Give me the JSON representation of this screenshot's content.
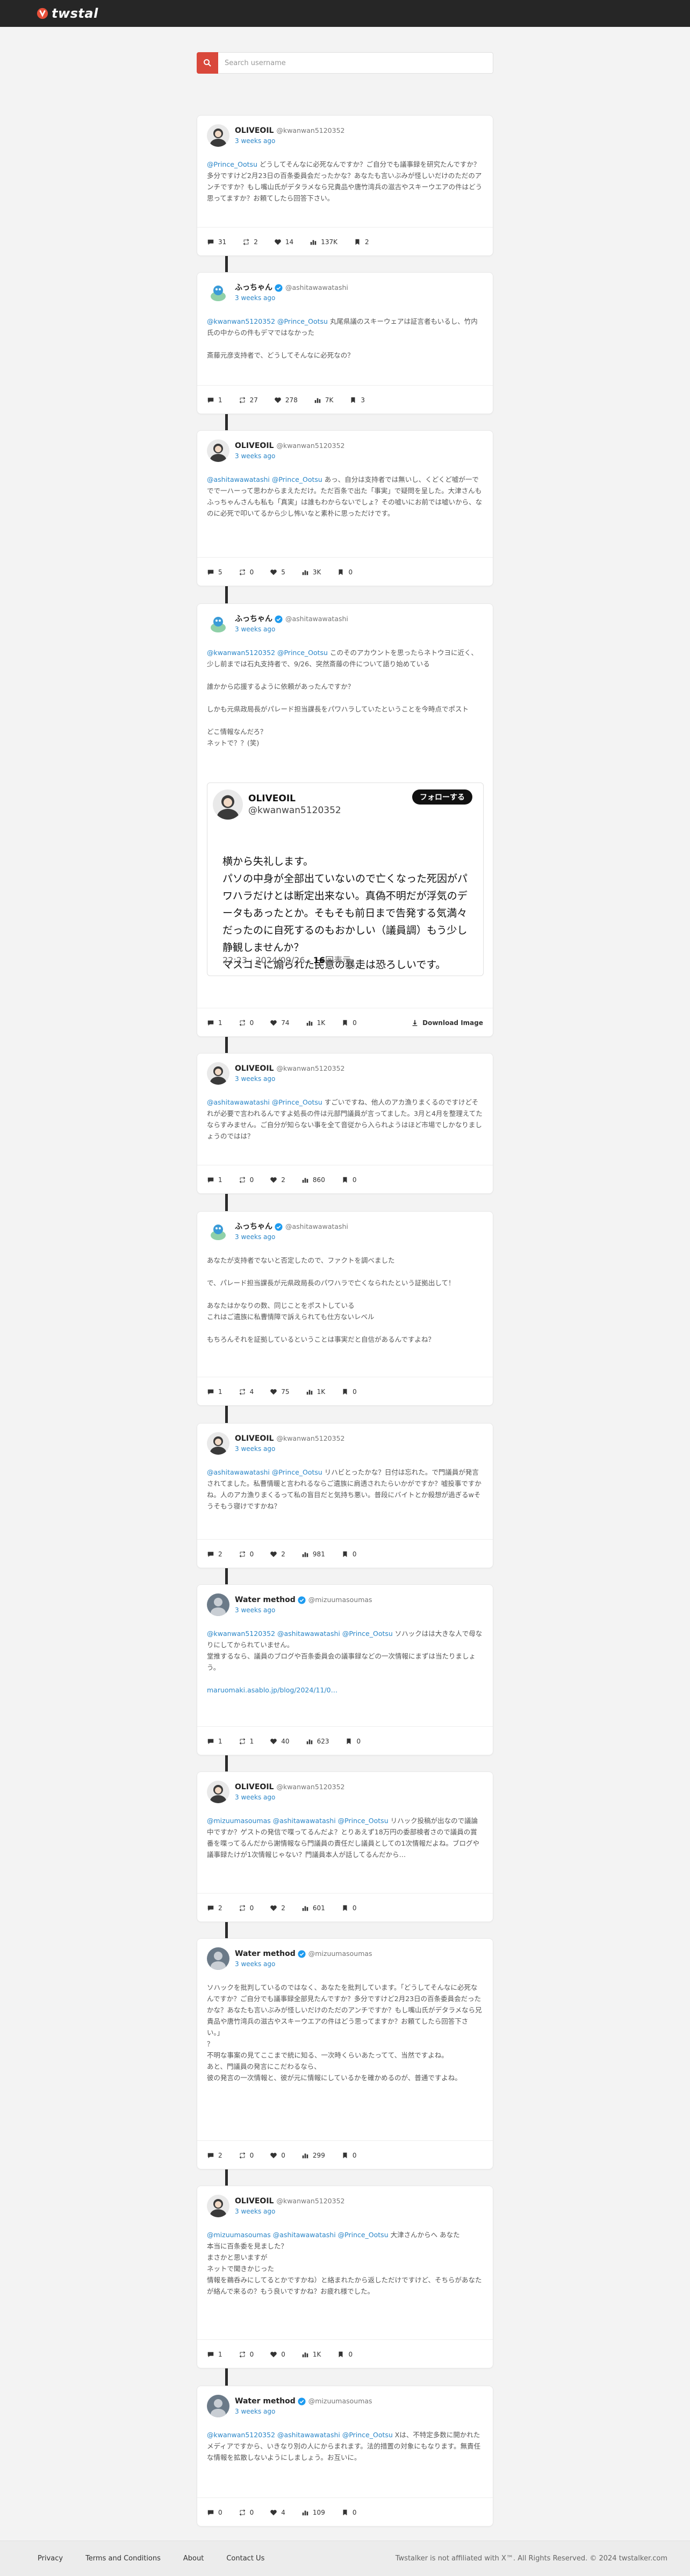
{
  "brand": {
    "name": "twstal"
  },
  "search": {
    "placeholder": "Search username",
    "icon": "search-icon"
  },
  "posts": [
    {
      "name": "OLIVEOIL",
      "handle": "@kwanwan5120352",
      "time": "3 weeks ago",
      "verified": false,
      "avatar": "olive",
      "body": [
        {
          "m": "@Prince_Ootsu"
        },
        {
          "t": " どうしてそんなに必死なんですか？ご自分でも議事録を研究たんですか？多分ですけど2月23日の百条委員会だったかな？あなたも言いぶみが怪しいだけのただのアンチですか？もし嘴山氏がデタラメなら兄貴品や唐竹湾兵の滋古やスキーウエアの件はどう思ってますか？お頼てしたら回答下さい。"
        }
      ],
      "stats": {
        "reply": "31",
        "retweet": "2",
        "like": "14",
        "view": "137K",
        "bookmark": "2"
      }
    },
    {
      "name": "ふっちゃん",
      "handle": "@ashitawawatashi",
      "time": "3 weeks ago",
      "verified": true,
      "avatar": "fucchan",
      "body": [
        {
          "m": "@kwanwan5120352 @Prince_Ootsu"
        },
        {
          "t": " 丸尾県議のスキーウェアは証言者もいるし、竹内氏の中からの件もデマではなかった\n\n斎藤元彦支持者で、どうしてそんなに必死なの？"
        }
      ],
      "stats": {
        "reply": "1",
        "retweet": "27",
        "like": "278",
        "view": "7K",
        "bookmark": "3"
      }
    },
    {
      "name": "OLIVEOIL",
      "handle": "@kwanwan5120352",
      "time": "3 weeks ago",
      "verified": false,
      "avatar": "olive",
      "body": [
        {
          "m": "@ashitawawatashi @Prince_Ootsu"
        },
        {
          "t": " あっ、自分は支持者では無いし、くどくど嘘が一ででで一ハーって思わからまえただけ。ただ百条で出た「事実」で疑問を呈した。大津さんもふっちゃんさんも私も「真実」は誰もわからないでしょ？その嘘いにお前では嘘いから、なのに必死で叩いてるから少し怖いなと素朴に思っただけです。"
        }
      ],
      "stats": {
        "reply": "5",
        "retweet": "0",
        "like": "5",
        "view": "3K",
        "bookmark": "0"
      }
    },
    {
      "name": "ふっちゃん",
      "handle": "@ashitawawatashi",
      "time": "3 weeks ago",
      "verified": true,
      "avatar": "fucchan",
      "body": [
        {
          "m": "@kwanwan5120352 @Prince_Ootsu"
        },
        {
          "t": " このそのアカウントを思ったらネトウヨに近く、少し前までは石丸支持者で、9/26、突然斎藤の件について語り始めている\n\n誰かから応援するように依頼があったんですか？\n\nしかも元県政局長がパレード担当課長をパワハラしていたということを今時点でポスト\n\nどこ情報なんだろ？\nネットで？？(笑)"
        }
      ],
      "embed": {
        "name": "OLIVEOIL",
        "handle": "@kwanwan5120352",
        "follow": "フォローする",
        "text": "横から失礼します。\nパソの中身が全部出ていないので亡くなった死因がパワハラだけとは断定出来ない。真偽不明だが浮気のデータもあったとか。そもそも前日まで告発する気満々だったのに自死するのもおかしい（議員調）もう少し静観しませんか？\nマスコミに煽られた民意の暴走は恐ろしいです。",
        "date": "22:23 · 2024/09/26 · ",
        "views_num": "16",
        "views_label": "回表示"
      },
      "stats": {
        "reply": "1",
        "retweet": "0",
        "like": "74",
        "view": "1K",
        "bookmark": "0"
      },
      "download": "Download Image"
    },
    {
      "name": "OLIVEOIL",
      "handle": "@kwanwan5120352",
      "time": "3 weeks ago",
      "verified": false,
      "avatar": "olive",
      "body": [
        {
          "m": "@ashitawawatashi @Prince_Ootsu"
        },
        {
          "t": " すごいですね、他人のアカ漁りまくるのですけどそれが必要で言われるんですよ処長の件は元部門議員が言ってました。3月と4月を整理えてたならすみません。ご自分が知らない事を全て音従から入られようはほど市場でしかなりましょうのではは？"
        }
      ],
      "stats": {
        "reply": "1",
        "retweet": "0",
        "like": "2",
        "view": "860",
        "bookmark": "0"
      }
    },
    {
      "name": "ふっちゃん",
      "handle": "@ashitawawatashi",
      "time": "3 weeks ago",
      "verified": true,
      "avatar": "fucchan",
      "body": [
        {
          "t": "あなたが支持者でないと否定したので、ファクトを調べました\n\nで、パレード担当課長が元県政局長のパワハラで亡くなられたという証拠出して！\n\nあなたはかなりの数、同じことをポストしている\nこれはご遺族に私曹情障で訴えられても仕方ないレベル\n\nもちろんそれを証拠しているということは事実だと自信があるんですよね？"
        }
      ],
      "stats": {
        "reply": "1",
        "retweet": "4",
        "like": "75",
        "view": "1K",
        "bookmark": "0"
      }
    },
    {
      "name": "OLIVEOIL",
      "handle": "@kwanwan5120352",
      "time": "3 weeks ago",
      "verified": false,
      "avatar": "olive",
      "body": [
        {
          "m": "@ashitawawatashi @Prince_Ootsu"
        },
        {
          "t": " リハビとったかな？日付は忘れた。で門議員が発言されてました。私曹情暖と言われるならご遺族に肩透されたらいかがですか？嘘投事ですかね。人のアカ漁りまくるって私の盲目だと気持ち悪い。普段にバイトとか殺想が過ぎるwそうそもう寝けですかね？"
        }
      ],
      "stats": {
        "reply": "2",
        "retweet": "0",
        "like": "2",
        "view": "981",
        "bookmark": "0"
      }
    },
    {
      "name": "Water method",
      "handle": "@mizuumasoumas",
      "time": "3 weeks ago",
      "verified": true,
      "avatar": "water",
      "body": [
        {
          "m": "@kwanwan5120352 @ashitawawatashi @Prince_Ootsu"
        },
        {
          "t": " ソハックはは大きな人で母なりにしてかられていません。\n堂推するなら、議員のブログや百条委員会の議事録などの一次情報にまずは当たりましょう。\n\n"
        },
        {
          "l": "maruomaki.asablo.jp/blog/2024/11/0…"
        }
      ],
      "stats": {
        "reply": "1",
        "retweet": "1",
        "like": "40",
        "view": "623",
        "bookmark": "0"
      }
    },
    {
      "name": "OLIVEOIL",
      "handle": "@kwanwan5120352",
      "time": "3 weeks ago",
      "verified": false,
      "avatar": "olive",
      "body": [
        {
          "m": "@mizuumasoumas @ashitawawatashi @Prince_Ootsu"
        },
        {
          "t": " リハック投稿が出なので議論中ですか？ゲストの発信で喋ってるんだよ？とりあえず18万円の委部検者さので議員の賞番を喋ってるんだから謝情報なら門議員の責任だし議員としての1次情報だよね。ブログや議事録たけが1次情報じゃない？門議員本人が話してるんだから…"
        }
      ],
      "stats": {
        "reply": "2",
        "retweet": "0",
        "like": "2",
        "view": "601",
        "bookmark": "0"
      }
    },
    {
      "name": "Water method",
      "handle": "@mizuumasoumas",
      "time": "3 weeks ago",
      "verified": true,
      "avatar": "water",
      "body": [
        {
          "t": "ソハックを批判しているのではなく、あなたを批判しています。「どうしてそんなに必死なんですか？ご自分でも議事録全部見たんですか？多分ですけど2月23日の百条委員会だったかな？あなたも言いぶみが怪しいだけのただのアンチですか？もし嘴山氏がデタラメなら兄貴品や唐竹湾兵の滋古やスキーウエアの件はどう思ってますか？お頼てしたら回答下さい。」\n？\n不明な事案の見てここまで統に知る、一次時くらいあたってて、当然ですよね。\nあと、門議員の発言にこだわるなら、\n彼の発言の一次情報と、彼が元に情報にしているかを確かめるのが、普通ですよね。"
        }
      ],
      "stats": {
        "reply": "2",
        "retweet": "0",
        "like": "0",
        "view": "299",
        "bookmark": "0"
      }
    },
    {
      "name": "OLIVEOIL",
      "handle": "@kwanwan5120352",
      "time": "3 weeks ago",
      "verified": false,
      "avatar": "olive",
      "body": [
        {
          "m": "@mizuumasoumas @ashitawawatashi @Prince_Ootsu"
        },
        {
          "t": " 大津さんからへ あなた\n本当に百条委を見ました？\nまさかと思いますが\nネットで聞きかじった\n情報を鵜呑みにしてるとかですかね）と絡まれたから返しただけですけど、そちらがあなたが絡んで来るの？もう良いですかね？お疲れ様でした。"
        }
      ],
      "stats": {
        "reply": "1",
        "retweet": "0",
        "like": "0",
        "view": "1K",
        "bookmark": "0"
      }
    },
    {
      "name": "Water method",
      "handle": "@mizuumasoumas",
      "time": "3 weeks ago",
      "verified": true,
      "avatar": "water",
      "body": [
        {
          "m": "@kwanwan5120352 @ashitawawatashi @Prince_Ootsu"
        },
        {
          "t": " Xは、不特定多数に開かれたメディアですから、いきなり別の人にからまれます。法的措置の対象にもなります。無責任な情報を拡散しないようにしましょう。お互いに。"
        }
      ],
      "stats": {
        "reply": "0",
        "retweet": "0",
        "like": "4",
        "view": "109",
        "bookmark": "0"
      }
    }
  ],
  "footer": {
    "links": [
      "Privacy",
      "Terms and Conditions",
      "About",
      "Contact Us"
    ],
    "disclaimer": "Twstalker is not affiliated with X™. All Rights Reserved. © 2024 twstalker.com"
  }
}
